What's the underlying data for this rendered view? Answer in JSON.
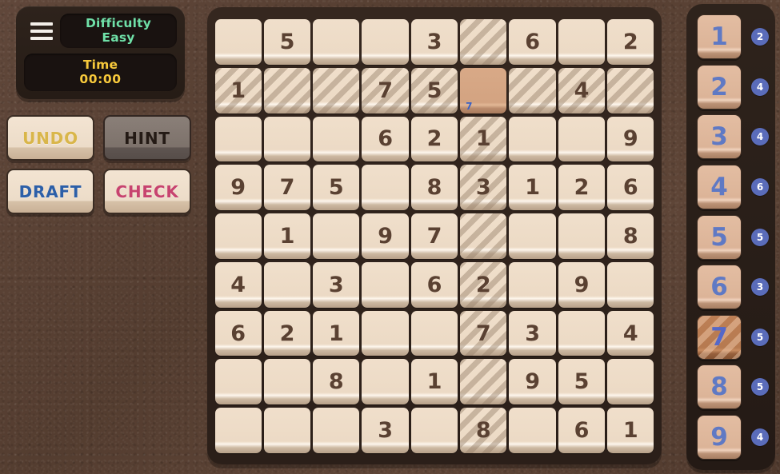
{
  "header": {
    "menu_icon": "hamburger-menu-icon",
    "difficulty_label": "Difficulty",
    "difficulty_value": "Easy",
    "time_label": "Time",
    "time_value": "00:00"
  },
  "actions": [
    {
      "id": "undo",
      "label": "UNDO",
      "color": "#d9b64a",
      "disabled": false
    },
    {
      "id": "hint",
      "label": "HINT",
      "color": "#241a15",
      "disabled": true
    },
    {
      "id": "draft",
      "label": "DRAFT",
      "color": "#2c5fa8",
      "disabled": false
    },
    {
      "id": "check",
      "label": "CHECK",
      "color": "#c7436f",
      "disabled": false
    }
  ],
  "board": {
    "selected": {
      "row": 1,
      "col": 5
    },
    "highlight_row": 1,
    "highlight_col": 5,
    "rows": [
      [
        "",
        "5",
        "",
        "",
        "3",
        "",
        "6",
        "",
        "2"
      ],
      [
        "1",
        "",
        "",
        "7",
        "5",
        "",
        "",
        "4",
        ""
      ],
      [
        "",
        "",
        "",
        "6",
        "2",
        "1",
        "",
        "",
        "9"
      ],
      [
        "9",
        "7",
        "5",
        "",
        "8",
        "3",
        "1",
        "2",
        "6"
      ],
      [
        "",
        "1",
        "",
        "9",
        "7",
        "",
        "",
        "",
        "8"
      ],
      [
        "4",
        "",
        "3",
        "",
        "6",
        "2",
        "",
        "9",
        ""
      ],
      [
        "6",
        "2",
        "1",
        "",
        "",
        "7",
        "3",
        "",
        "4"
      ],
      [
        "",
        "",
        "8",
        "",
        "1",
        "",
        "9",
        "5",
        ""
      ],
      [
        "",
        "",
        "",
        "3",
        "",
        "8",
        "",
        "6",
        "1"
      ]
    ],
    "notes": {
      "1_5": "7"
    }
  },
  "numpad": {
    "active": "7",
    "buttons": [
      {
        "value": "1",
        "remaining": "2"
      },
      {
        "value": "2",
        "remaining": "4"
      },
      {
        "value": "3",
        "remaining": "4"
      },
      {
        "value": "4",
        "remaining": "6"
      },
      {
        "value": "5",
        "remaining": "5"
      },
      {
        "value": "6",
        "remaining": "3"
      },
      {
        "value": "7",
        "remaining": "5"
      },
      {
        "value": "8",
        "remaining": "5"
      },
      {
        "value": "9",
        "remaining": "4"
      }
    ]
  },
  "colors": {
    "background": "#5b4233",
    "panel": "#2e231c",
    "cell": "#ecdac5",
    "cell_selected": "#d3a381",
    "digit": "#5a4132",
    "numpad_digit": "#5f79c4",
    "badge": "#5a6cba",
    "difficulty_text": "#6fe0a8",
    "time_text": "#f7c93b"
  }
}
